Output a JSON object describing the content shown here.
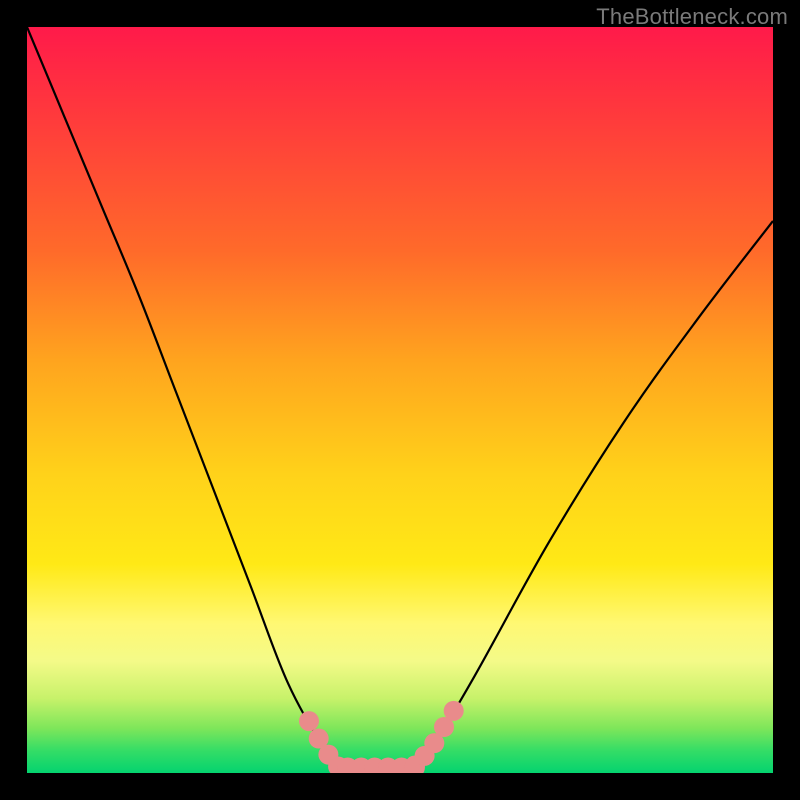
{
  "watermark": "TheBottleneck.com",
  "chart_data": {
    "type": "line",
    "title": "",
    "xlabel": "",
    "ylabel": "",
    "xlim": [
      0,
      1
    ],
    "ylim": [
      0,
      1
    ],
    "series": [
      {
        "name": "bottleneck-curve",
        "x": [
          0.0,
          0.05,
          0.1,
          0.15,
          0.2,
          0.25,
          0.3,
          0.35,
          0.4,
          0.415,
          0.43,
          0.48,
          0.5,
          0.52,
          0.54,
          0.6,
          0.7,
          0.8,
          0.9,
          1.0
        ],
        "values": [
          1.0,
          0.88,
          0.76,
          0.64,
          0.51,
          0.38,
          0.25,
          0.12,
          0.03,
          0.01,
          0.0,
          0.0,
          0.0,
          0.01,
          0.03,
          0.13,
          0.31,
          0.47,
          0.61,
          0.74
        ]
      }
    ],
    "flat_zone": {
      "x_start": 0.43,
      "x_end": 0.52
    },
    "marker_color": "#e98b8b",
    "curve_color": "#000000"
  },
  "colors": {
    "page_background": "#000000",
    "watermark_text": "#7a7a7a"
  }
}
